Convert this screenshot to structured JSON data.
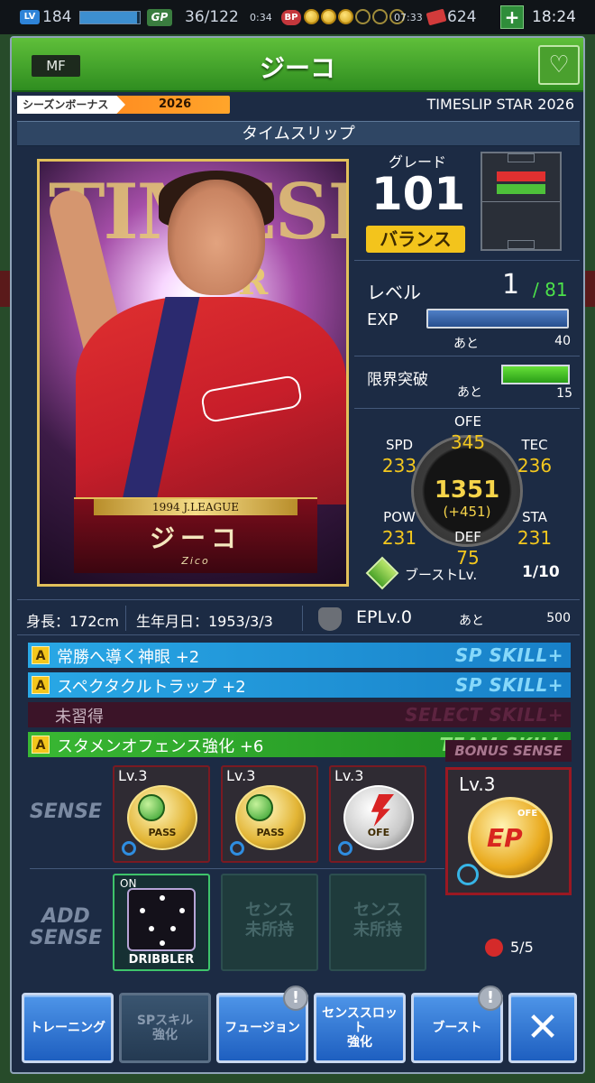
{
  "status_bar": {
    "lv_badge": "LV",
    "lv": "184",
    "lv_progress": 0.95,
    "gp_badge": "GP",
    "gp": "36/122",
    "gp_timer": "0:34",
    "bp_badge": "BP",
    "bp_filled": 3,
    "bp_total": 6,
    "bp_timer": "07:33",
    "tickets": "624",
    "time": "18:24"
  },
  "header": {
    "position": "MF",
    "title": "ジーコ"
  },
  "season": {
    "label": "シーズンボーナス",
    "year": "2026",
    "series": "TIMESLIP STAR 2026"
  },
  "section_title": "タイムスリップ",
  "card": {
    "big_text": "TIMESLIP",
    "league": "1994 J.LEAGUE",
    "name": "ジーコ",
    "roman": "Zico",
    "rarity_letter": "R"
  },
  "grade": {
    "label": "グレード",
    "value": "101",
    "type": "バランス"
  },
  "level": {
    "label": "レベル",
    "value": "1",
    "max": "/ 81",
    "exp_label": "EXP",
    "exp_ato": "あと",
    "exp_remaining": "40",
    "limit_label": "限界突破",
    "limit_ato": "あと",
    "limit_remaining": "15"
  },
  "stats": {
    "ofe_label": "OFE",
    "ofe": "345",
    "spd_label": "SPD",
    "spd": "233",
    "tec_label": "TEC",
    "tec": "236",
    "pow_label": "POW",
    "pow": "231",
    "sta_label": "STA",
    "sta": "231",
    "def_label": "DEF",
    "def": "75",
    "total": "1351",
    "bonus": "(+451)",
    "boost_label": "ブーストLv.",
    "boost_value": "1/10"
  },
  "profile": {
    "height": "身長：172cm",
    "birth": "生年月日：1953/3/3",
    "ep_level": "EPLv.0",
    "ep_ato": "あと",
    "ep_remaining": "500"
  },
  "skills": [
    {
      "badge": "A",
      "name": "常勝へ導く神眼 +2",
      "type": "SP SKILL+"
    },
    {
      "badge": "A",
      "name": "スペクタクルトラップ +2",
      "type": "SP SKILL+"
    },
    {
      "badge": "",
      "name": "未習得",
      "type": "SELECT SKILL+"
    },
    {
      "badge": "A",
      "name": "スタメンオフェンス強化 +6",
      "type": "TEAM SKILL"
    }
  ],
  "sense": {
    "label": "SENSE",
    "add_label_1": "ADD",
    "add_label_2": "SENSE",
    "slots": [
      {
        "lv": "Lv.3",
        "emblem": "PASS"
      },
      {
        "lv": "Lv.3",
        "emblem": "PASS"
      },
      {
        "lv": "Lv.3",
        "emblem": "OFE"
      }
    ],
    "add_slots": [
      {
        "on": "ON",
        "label": "DRIBBLER"
      },
      {
        "empty_1": "センス",
        "empty_2": "未所持"
      },
      {
        "empty_1": "センス",
        "empty_2": "未所持"
      }
    ],
    "bonus_title": "BONUS SENSE",
    "bonus_lv": "Lv.3",
    "bonus_emblem": "EP",
    "bonus_emblem_sub": "OFE",
    "bonus_count": "5/5"
  },
  "buttons": {
    "training": "トレーニング",
    "sp_skill_1": "SPスキル",
    "sp_skill_2": "強化",
    "fusion": "フュージョン",
    "sense_slot_1": "センススロット",
    "sense_slot_2": "強化",
    "boost": "ブースト",
    "close": "✕",
    "alert": "!"
  },
  "colors": {
    "header_green": "#3fa42a",
    "sp_skill_blue": "#1f98d8",
    "team_skill_green": "#2ea42b",
    "select_skill_maroon": "#3b1428",
    "stat_gold": "#f3c71e",
    "button_blue": "#2f77d4"
  }
}
